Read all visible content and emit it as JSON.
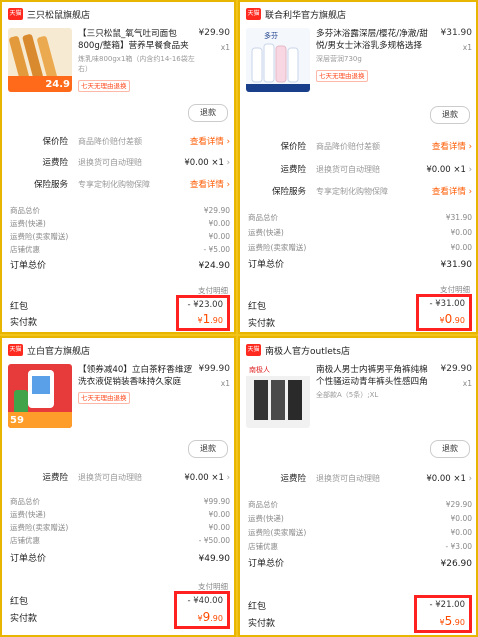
{
  "panels": [
    {
      "store": "三只松鼠旗舰店",
      "product": {
        "title": "【三只松鼠_氧气吐司面包800g/整箱】营养早餐食品夹心小零...",
        "price": "¥29.90",
        "qty": "x1",
        "spec": "炼乳味800gx1箱（内含约14-16袋左右）",
        "tag": "七天无理由退换",
        "thumb_text": "24.9"
      },
      "refund": "退款",
      "services": [
        {
          "label": "保价险",
          "desc": "商品降价赔付差额",
          "action": "查看详情"
        },
        {
          "label": "运费险",
          "desc": "退换货可自动理赔",
          "value": "¥0.00 ×1"
        },
        {
          "label": "保险服务",
          "desc": "专享定制化购物保障",
          "action": "查看详情"
        }
      ],
      "fees": [
        {
          "label": "商品总价",
          "value": "¥29.90"
        },
        {
          "label": "运费(快递)",
          "value": "¥0.00"
        },
        {
          "label": "运费险(卖家赠送)",
          "value": "¥0.00"
        },
        {
          "label": "店铺优惠",
          "value": "- ¥5.00"
        }
      ],
      "total": {
        "label": "订单总价",
        "value": "¥24.90"
      },
      "detail_link": "支付明细",
      "redpacket": {
        "label": "红包",
        "value": "- ¥23.00"
      },
      "paid": {
        "label": "实付款",
        "symbol": "¥",
        "int": "1",
        "dec": ".90"
      }
    },
    {
      "store": "联合利华官方旗舰店",
      "product": {
        "title": "多芬沐浴露深层/樱花/净澈/甜悦/男女士沐浴乳多规格选择",
        "price": "¥31.90",
        "qty": "x1",
        "spec": "深层营润730g",
        "tag": "七天无理由退换",
        "thumb_text": "多芬"
      },
      "refund": "退款",
      "services": [
        {
          "label": "保价险",
          "desc": "商品降价赔付差额",
          "action": "查看详情"
        },
        {
          "label": "运费险",
          "desc": "退换货可自动理赔",
          "value": "¥0.00 ×1"
        },
        {
          "label": "保险服务",
          "desc": "专享定制化购物保障",
          "action": "查看详情"
        }
      ],
      "fees": [
        {
          "label": "商品总价",
          "value": "¥31.90"
        },
        {
          "label": "运费(快递)",
          "value": "¥0.00"
        },
        {
          "label": "运费险(卖家赠送)",
          "value": "¥0.00"
        }
      ],
      "total": {
        "label": "订单总价",
        "value": "¥31.90"
      },
      "detail_link": "支付明细",
      "redpacket": {
        "label": "红包",
        "value": "- ¥31.00"
      },
      "paid": {
        "label": "实付款",
        "symbol": "¥",
        "int": "0",
        "dec": ".90"
      }
    },
    {
      "store": "立白官方旗舰店",
      "product": {
        "title": "【领券减40】立白茶籽香维逻洗衣液促销装香味持久家庭整...",
        "price": "¥99.90",
        "qty": "x1",
        "spec": "",
        "tag": "七天无理由退换",
        "thumb_text": "59"
      },
      "refund": "退款",
      "services": [
        {
          "label": "运费险",
          "desc": "退换货可自动理赔",
          "value": "¥0.00 ×1"
        }
      ],
      "fees": [
        {
          "label": "商品总价",
          "value": "¥99.90"
        },
        {
          "label": "运费(快递)",
          "value": "¥0.00"
        },
        {
          "label": "运费险(卖家赠送)",
          "value": "¥0.00"
        },
        {
          "label": "店铺优惠",
          "value": "- ¥50.00"
        }
      ],
      "total": {
        "label": "订单总价",
        "value": "¥49.90"
      },
      "detail_link": "支付明细",
      "redpacket": {
        "label": "红包",
        "value": "- ¥40.00"
      },
      "paid": {
        "label": "实付款",
        "symbol": "¥",
        "int": "9",
        "dec": ".90"
      }
    },
    {
      "store": "南极人官方outlets店",
      "product": {
        "title": "南极人男士内裤男平角裤纯棉个性骚运动青年裤头性感四角短...",
        "price": "¥29.90",
        "qty": "x1",
        "spec": "全部款A（5条）;XL",
        "tag": "七天无理由退换",
        "thumb_text": "南极人"
      },
      "refund": "退款",
      "services": [
        {
          "label": "运费险",
          "desc": "退换货可自动理赔",
          "value": "¥0.00 ×1"
        }
      ],
      "fees": [
        {
          "label": "商品总价",
          "value": "¥29.90"
        },
        {
          "label": "运费(快递)",
          "value": "¥0.00"
        },
        {
          "label": "运费险(卖家赠送)",
          "value": "¥0.00"
        },
        {
          "label": "店铺优惠",
          "value": "- ¥3.00"
        }
      ],
      "total": {
        "label": "订单总价",
        "value": "¥26.90"
      },
      "detail_link": "支付明细",
      "redpacket": {
        "label": "红包",
        "value": "- ¥21.00"
      },
      "paid": {
        "label": "实付款",
        "symbol": "¥",
        "int": "5",
        "dec": ".90"
      }
    }
  ],
  "badge": "天猫",
  "colors": {
    "accent": "#ff5a00",
    "highlight": "#ff2020",
    "background": "#f2c318"
  }
}
